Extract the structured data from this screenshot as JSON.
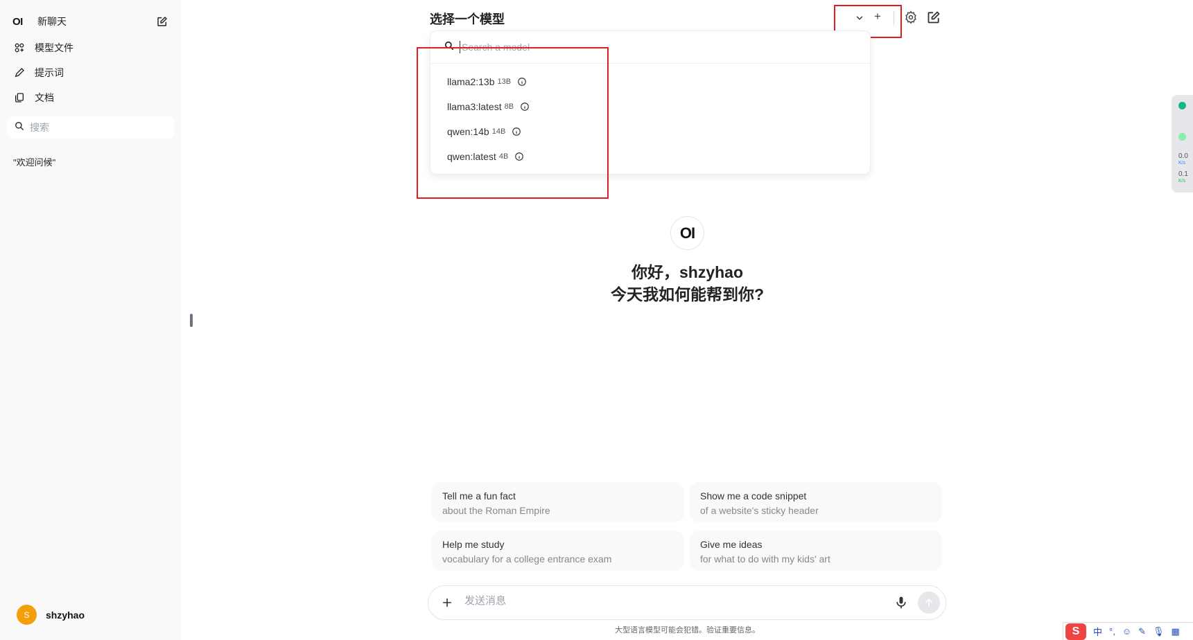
{
  "sidebar": {
    "logo": "OI",
    "new_chat_label": "新聊天",
    "nav": [
      {
        "label": "模型文件",
        "icon": "model-files-icon"
      },
      {
        "label": "提示词",
        "icon": "pencil-icon"
      },
      {
        "label": "文档",
        "icon": "documents-icon"
      }
    ],
    "search_placeholder": "搜索",
    "chats": [
      "\"欢迎问候\""
    ],
    "user": {
      "initial": "S",
      "name": "shzyhao"
    }
  },
  "header": {
    "title": "选择一个模型",
    "add_label": "+"
  },
  "model_dropdown": {
    "search_placeholder": "Search a model",
    "models": [
      {
        "name": "llama2:13b",
        "size": "13B"
      },
      {
        "name": "llama3:latest",
        "size": "8B"
      },
      {
        "name": "qwen:14b",
        "size": "14B"
      },
      {
        "name": "qwen:latest",
        "size": "4B"
      }
    ]
  },
  "main": {
    "logo": "OI",
    "greeting_line1": "你好，shzyhao",
    "greeting_line2": "今天我如何能帮到你?",
    "suggestions": [
      {
        "title": "Tell me a fun fact",
        "subtitle": "about the Roman Empire"
      },
      {
        "title": "Show me a code snippet",
        "subtitle": "of a website's sticky header"
      },
      {
        "title": "Help me study",
        "subtitle": "vocabulary for a college entrance exam"
      },
      {
        "title": "Give me ideas",
        "subtitle": "for what to do with my kids' art"
      }
    ],
    "composer_placeholder": "发送消息",
    "disclaimer": "大型语言模型可能会犯错。验证重要信息。"
  },
  "net_widget": {
    "upload": "0.0",
    "upload_unit": "K/s",
    "download": "0.1",
    "download_unit": "K/s"
  },
  "ime": {
    "logo": "S",
    "mode": "中",
    "punct": "°,"
  },
  "colors": {
    "annotation": "#e11d21",
    "avatar": "#f59e0b",
    "sidebar_bg": "#f9f9f9"
  }
}
